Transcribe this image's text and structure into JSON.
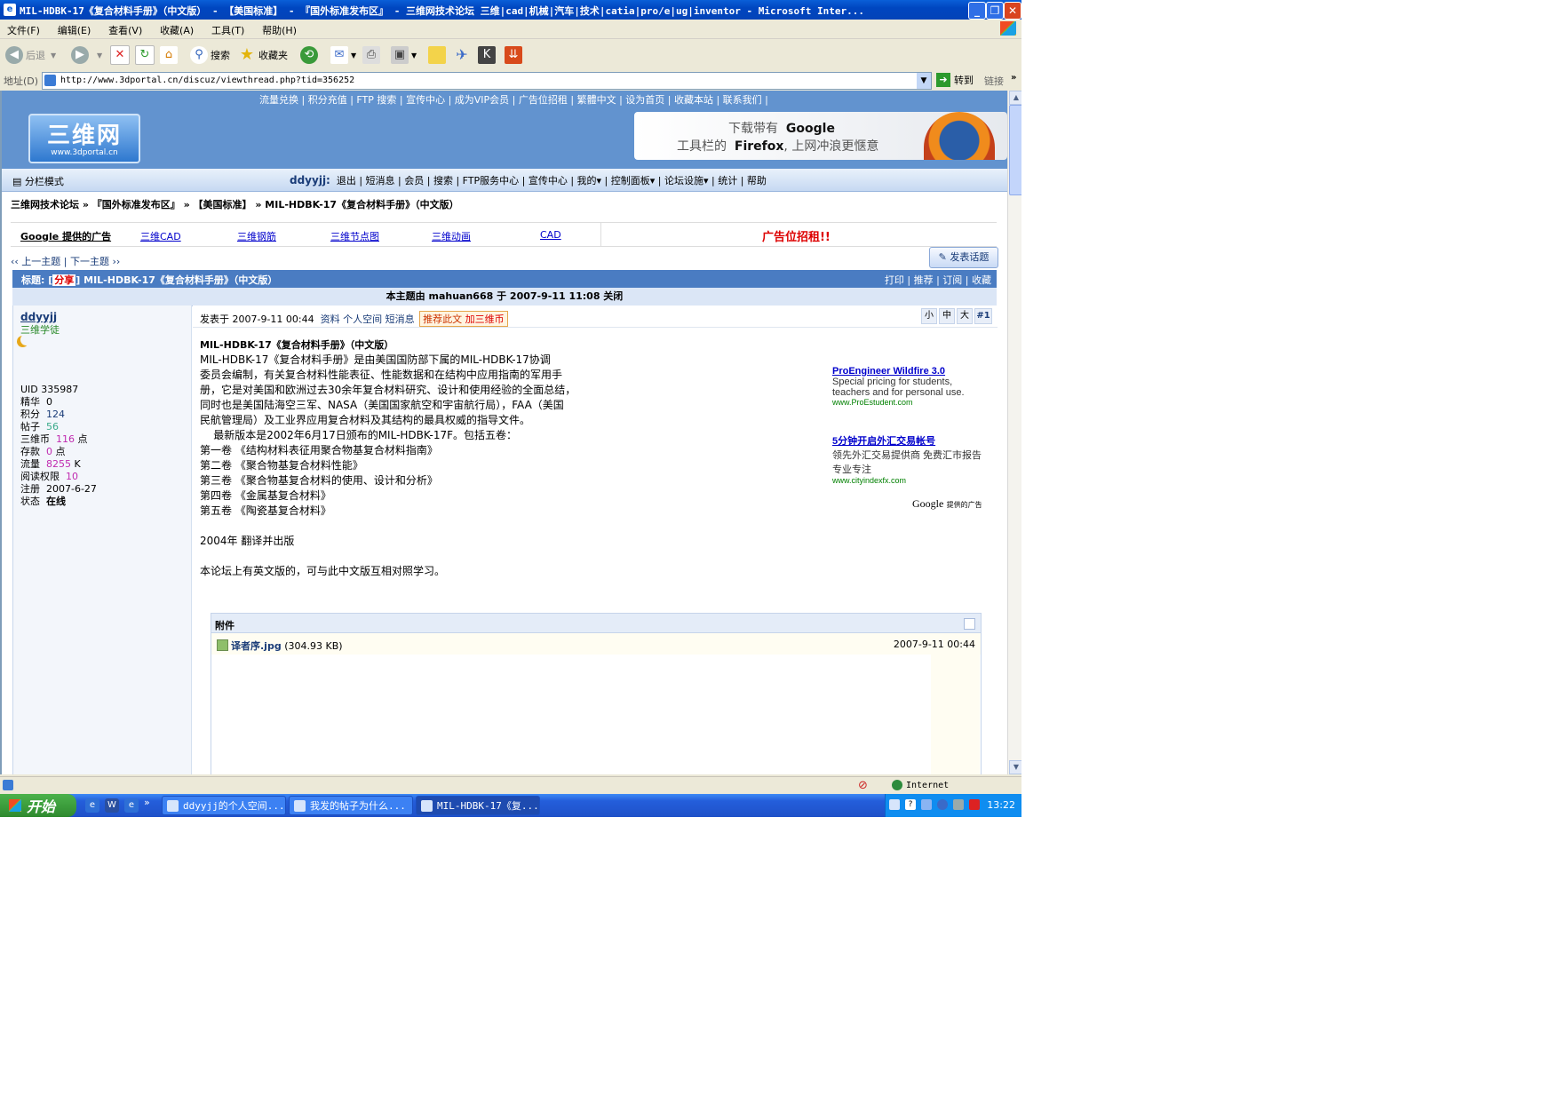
{
  "window": {
    "title": "MIL-HDBK-17《复合材料手册》（中文版） - 【美国标准】 - 『国外标准发布区』 - 三维网技术论坛 三维|cad|机械|汽车|技术|catia|pro/e|ug|inventor - Microsoft Inter...",
    "min": "_",
    "max": "❐",
    "close": "✕"
  },
  "menu": [
    "文件(F)",
    "编辑(E)",
    "查看(V)",
    "收藏(A)",
    "工具(T)",
    "帮助(H)"
  ],
  "toolbar": {
    "back": "后退",
    "search": "搜索",
    "favorites": "收藏夹"
  },
  "address": {
    "label": "地址(D)",
    "url": "http://www.3dportal.cn/discuz/viewthread.php?tid=356252",
    "go": "转到",
    "links": "链接"
  },
  "forum": {
    "top_links": "流量兑换 | 积分充值 | FTP 搜索 | 宣传中心 | 成为VIP会员 | 广告位招租 | 繁體中文 | 设为首页 | 收藏本站 | 联系我们 |",
    "logo_title": "三维网",
    "logo_sub": "www.3dportal.cn",
    "banner_line1_pre": "下载带有",
    "banner_line1_brand": "Google",
    "banner_line2_pre": "工具栏的",
    "banner_line2_brand": "Firefox",
    "banner_line2_post": ", 上网冲浪更惬意",
    "mode": "分栏模式",
    "username": "ddyyjj:",
    "nav_links": "退出 | 短消息 | 会员 | 搜索 | FTP服务中心 | 宣传中心 | 我的▾ | 控制面板▾ | 论坛设施▾ | 统计 | 帮助",
    "breadcrumb": "三维网技术论坛 » 『国外标准发布区』 » 【美国标准】 » MIL-HDBK-17《复合材料手册》（中文版）",
    "google_ads_label": "Google 提供的广告",
    "ad_links": [
      "三维CAD",
      "三维钢筋",
      "三维节点图",
      "三维动画",
      "CAD"
    ],
    "ad_big": "广告位招租!!",
    "prev_next": "‹‹ 上一主题 | 下一主题 ››",
    "new_post": "发表话题",
    "thread_title_pre": "标题: [",
    "thread_tag": "分享",
    "thread_title": "] MIL-HDBK-17《复合材料手册》（中文版）",
    "thread_actions": "打印 | 推荐 | 订阅 | 收藏",
    "closed_notice": "本主题由 mahuan668 于 2007-9-11 11:08 关闭"
  },
  "author": {
    "name": "ddyyjj",
    "rank": "三维学徒",
    "stats": [
      {
        "label": "UID",
        "value": "335987",
        "unit": ""
      },
      {
        "label": "精华",
        "value": "0",
        "unit": ""
      },
      {
        "label": "积分",
        "value": "124",
        "unit": ""
      },
      {
        "label": "帖子",
        "value": "56",
        "unit": ""
      },
      {
        "label": "三维币",
        "value": "116",
        "unit": "点"
      },
      {
        "label": "存款",
        "value": "0",
        "unit": "点"
      },
      {
        "label": "流量",
        "value": "8255",
        "unit": "K"
      },
      {
        "label": "阅读权限",
        "value": "10",
        "unit": ""
      },
      {
        "label": "注册",
        "value": "2007-6-27",
        "unit": ""
      },
      {
        "label": "状态",
        "value": "在线",
        "unit": ""
      }
    ]
  },
  "post": {
    "posted": "发表于 2007-9-11 00:44",
    "links": "资料  个人空间  短消息",
    "recommend": "推荐此文",
    "add_coin": "加三维币",
    "sizes": [
      "小",
      "中",
      "大"
    ],
    "floor": "#1",
    "heading": "MIL-HDBK-17《复合材料手册》（中文版）",
    "lines": [
      "MIL-HDBK-17《复合材料手册》是由美国国防部下属的MIL-HDBK-17协调",
      "委员会编制，有关复合材料性能表征、性能数据和在结构中应用指南的军用手",
      "册，它是对美国和欧洲过去30余年复合材料研究、设计和使用经验的全面总结，",
      "同时也是美国陆海空三军、NASA（美国国家航空和宇宙航行局），FAA（美国",
      "民航管理局）及工业界应用复合材料及其结构的最具权威的指导文件。",
      "    最新版本是2002年6月17日颁布的MIL-HDBK-17F。包括五卷：",
      "第一卷 《结构材料表征用聚合物基复合材料指南》",
      "第二卷 《聚合物基复合材料性能》",
      "第三卷 《聚合物基复合材料的使用、设计和分析》",
      "第四卷 《金属基复合材料》",
      "第五卷 《陶瓷基复合材料》",
      "",
      "2004年 翻译并出版",
      "",
      "本论坛上有英文版的，可与此中文版互相对照学习。"
    ],
    "ads": [
      {
        "title": "ProEngineer Wildfire 3.0",
        "desc": "Special pricing for students, teachers and for personal use.",
        "url": "www.ProEstudent.com"
      },
      {
        "title": "5分钟开启外汇交易帐号",
        "desc": "领先外汇交易提供商 免费汇市报告 专业专注",
        "url": "www.cityindexfx.com"
      }
    ],
    "ads_footer_brand": "Google",
    "ads_footer_text": "提供的广告",
    "attachment_label": "附件",
    "attachment_name": "译者序.jpg",
    "attachment_size": "(304.93 KB)",
    "attachment_date": "2007-9-11 00:44"
  },
  "status": {
    "zone": "Internet"
  },
  "taskbar": {
    "start": "开始",
    "tasks": [
      "ddyyjj的个人空间...",
      "我发的帖子为什么...",
      "MIL-HDBK-17《复..."
    ],
    "clock": "13:22"
  }
}
